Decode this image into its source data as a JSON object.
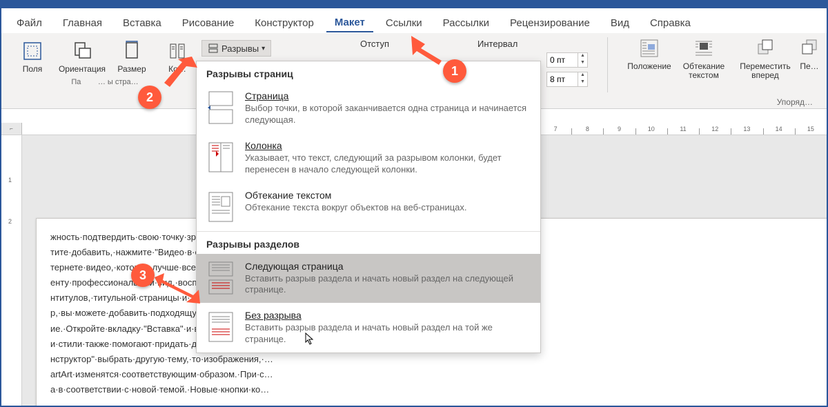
{
  "tabs": {
    "file": "Файл",
    "home": "Главная",
    "insert": "Вставка",
    "draw": "Рисование",
    "design": "Конструктор",
    "layout": "Макет",
    "references": "Ссылки",
    "mailings": "Рассылки",
    "review": "Рецензирование",
    "view": "Вид",
    "help": "Справка"
  },
  "ribbon": {
    "margins": "Поля",
    "orientation": "Ориентация",
    "size": "Размер",
    "columns": "Ко…",
    "breaks": "Разрывы",
    "page_setup_partial": "… ы стра…",
    "indent_label": "Отступ",
    "spacing_label": "Интервал",
    "spin1": "0 пт",
    "spin2": "8 пт",
    "position": "Положение",
    "wrap_text": "Обтекание текстом",
    "bring_forward": "Переместить вперед",
    "send_back": "Пе…",
    "arrange_label": "Упоряд…",
    "pa_left": "Па"
  },
  "menu": {
    "section1": "Разрывы страниц",
    "page_title": "Страница",
    "page_desc": "Выбор точки, в которой заканчивается одна страница и начинается следующая.",
    "column_title": "Колонка",
    "column_desc": "Указывает, что текст, следующий за разрывом колонки, будет перенесен в начало следующей колонки.",
    "wrap_title": "Обтекание текстом",
    "wrap_desc": "Обтекание текста вокруг объектов на веб-страницах.",
    "section2": "Разрывы разделов",
    "next_title": "Следующая страница",
    "next_desc": "Вставить разрыв раздела и начать новый раздел на следующей странице.",
    "continuous_title": "Без разрыва",
    "continuous_desc": "Вставить разрыв раздела и начать новый раздел на той же странице."
  },
  "ruler": {
    "marks": [
      "7",
      "8",
      "9",
      "10",
      "11",
      "12",
      "13",
      "14",
      "15"
    ],
    "vmarks": [
      "",
      "1",
      "2"
    ]
  },
  "doc_lines": [
    "жность·подтвердить·свою·точку·зрения.·Чтобы·вста…",
    "тите·добавить,·нажмите·\"Видео·в·сети\".·Вы·также·м…",
    "тернете·видео,·которое·лучше·всего·подходит·для·…",
    "енту·профессиональный·вид,·воспользуйтесь·досту…",
    "нтитулов,·титульной·страницы·и·текстовых·полей,·…",
    "р,·вы·можете·добавить·подходящую·титульную·стр…",
    "ие.·Откройте·вкладку·\"Вставка\"·и·выберите·нужные…",
    "и·стили·также·помогают·придать·документу·…",
    "нструктор\"·выбрать·другую·тему,·то·изображения,·…",
    "artArt·изменятся·соответствующим·образом.·При·с…",
    "а·в·соответствии·с·новой·темой.·Новые·кнопки·ко…"
  ],
  "annotations": {
    "one": "1",
    "two": "2",
    "three": "3"
  }
}
